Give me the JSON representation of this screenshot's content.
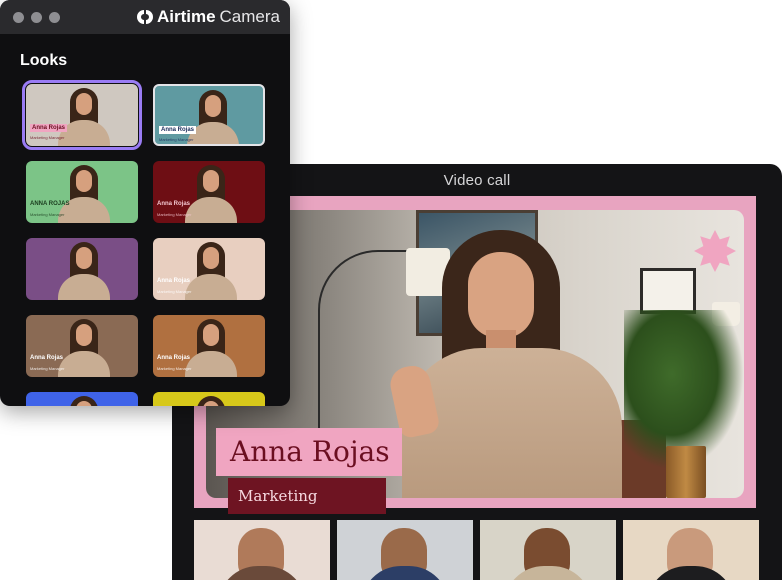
{
  "camera_app": {
    "brand_name_bold": "Airtime",
    "brand_name_light": "Camera",
    "looks_heading": "Looks",
    "looks": [
      {
        "name": "Anna Rojas",
        "subtitle": "Marketing Manager",
        "bg": "#cfc8c0",
        "selected": true,
        "tag_bg": "#f0a5c1",
        "tag_color": "#6b0f21"
      },
      {
        "name": "Anna Rojas",
        "subtitle": "Marketing Manager",
        "bg": "#5f9aa1",
        "selected": false,
        "outlined": true,
        "tag_bg": "#ffffff",
        "tag_color": "#1a2a5a"
      },
      {
        "name": "ANNA ROJAS",
        "subtitle": "Marketing Manager",
        "bg": "#7cc487",
        "selected": false,
        "tag_bg": "",
        "tag_color": "#1b3d1f"
      },
      {
        "name": "Anna Rojas",
        "subtitle": "Marketing Manager",
        "bg": "#6e0e14",
        "selected": false,
        "tag_bg": "",
        "tag_color": "#f3c6cf"
      },
      {
        "name": "",
        "subtitle": "",
        "bg": "#7a4e86",
        "selected": false
      },
      {
        "name": "Anna Rojas",
        "subtitle": "Marketing Manager",
        "bg": "#e8cfc0",
        "selected": false,
        "tag_bg": "",
        "tag_color": "#ffffff"
      },
      {
        "name": "Anna Rojas",
        "subtitle": "Marketing Manager",
        "bg": "#8a6a54",
        "selected": false,
        "tag_bg": "",
        "tag_color": "#ffffff"
      },
      {
        "name": "Anna Rojas",
        "subtitle": "Marketing Manager",
        "bg": "#b07040",
        "selected": false,
        "tag_bg": "",
        "tag_color": "#ffffff"
      },
      {
        "name": "",
        "subtitle": "",
        "bg": "#3f63e8",
        "selected": false
      },
      {
        "name": "",
        "subtitle": "",
        "bg": "#d7c81a",
        "selected": false
      }
    ]
  },
  "video_call": {
    "title": "Video call",
    "presenter_name": "Anna Rojas",
    "presenter_title": "Marketing Manager",
    "frame_color": "#e8a4c0",
    "participants": [
      {
        "skin": "#b07a5a",
        "bg": "#e9dcd4",
        "shirt": "#6a4a3a"
      },
      {
        "skin": "#9a6a4a",
        "bg": "#cfd2d6",
        "shirt": "#2c3e66"
      },
      {
        "skin": "#7a4c30",
        "bg": "#d8d4c8",
        "shirt": "#c7b59a"
      },
      {
        "skin": "#c99a7c",
        "bg": "#e7d8c4",
        "shirt": "#1d1d1f"
      }
    ]
  }
}
